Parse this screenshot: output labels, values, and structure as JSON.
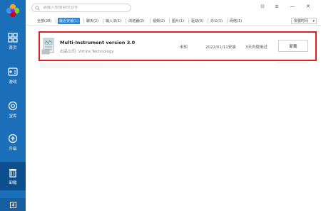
{
  "sidebar": {
    "items": [
      {
        "label": "首页",
        "icon": "home-icon"
      },
      {
        "label": "游戏",
        "icon": "gamepad-icon"
      },
      {
        "label": "宝库",
        "icon": "treasury-icon"
      },
      {
        "label": "升级",
        "icon": "upgrade-icon"
      },
      {
        "label": "卸载",
        "icon": "trash-icon"
      }
    ],
    "bottom_icon": "download-icon",
    "active_index": 4
  },
  "search": {
    "placeholder": "请输入想搜索的软件"
  },
  "window_controls": {
    "skin": "⊙",
    "menu": "≡",
    "minimize": "—",
    "close": "✕"
  },
  "tabs": [
    {
      "label": "全部(28)"
    },
    {
      "label": "最近安装(1)"
    },
    {
      "label": "聊天(2)"
    },
    {
      "label": "输入法(1)"
    },
    {
      "label": "浏览器(2)"
    },
    {
      "label": "视频(2)"
    },
    {
      "label": "图片(1)"
    },
    {
      "label": "驱动(0)"
    },
    {
      "label": "办公(1)"
    },
    {
      "label": "网络(1)"
    }
  ],
  "active_tab": 1,
  "sort": {
    "label": "安装时间"
  },
  "apps": [
    {
      "name": "Multi-Instrument version 3.0",
      "publisher": "出品公司: Virtins Technology",
      "size": "未知",
      "date": "2022/01/11安装",
      "usage": "3天内使用过",
      "action": "卸载"
    }
  ],
  "colors": {
    "sidebar": "#1a6fb8",
    "accent": "#1e86e0",
    "highlight": "#e02020"
  }
}
